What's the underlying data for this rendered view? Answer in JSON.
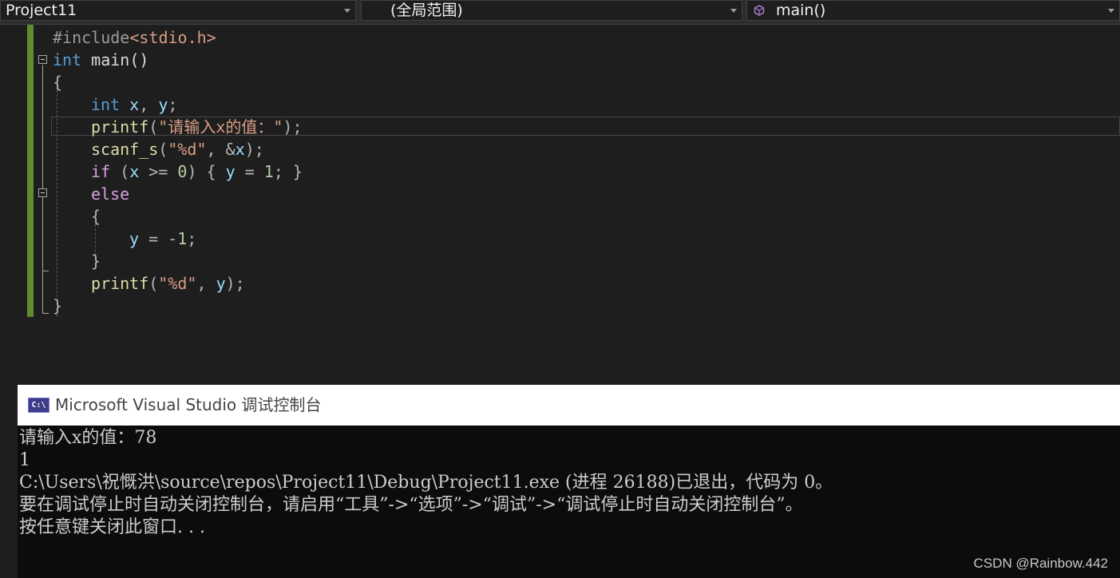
{
  "navbar": {
    "project": "Project11",
    "scope": "(全局范围)",
    "member": "main()"
  },
  "code": {
    "l1": {
      "a": "#include",
      "b": "<stdio.h>"
    },
    "l2": {
      "kw": "int",
      "rest": " main()"
    },
    "l3": "{",
    "l4": {
      "kw": "int",
      "x": "x",
      "comma": ",",
      "y": "y",
      "semi": ";"
    },
    "l5": {
      "fn": "printf",
      "open": "(",
      "str": "\"请输入x的值：\"",
      "close": ");"
    },
    "l6": {
      "fn": "scanf_s",
      "open": "(",
      "str": "\"%d\"",
      "comma": ", &",
      "x": "x",
      "close": ");"
    },
    "l7": {
      "kw": "if",
      "p1": " (",
      "x": "x",
      "op": " >= ",
      "n0": "0",
      "p2": ") { ",
      "y": "y",
      "eq": " = ",
      "n1": "1",
      "end": "; }"
    },
    "l8": "else",
    "l9": "{",
    "l10": {
      "y": "y",
      "eq": " = -",
      "n": "1",
      "semi": ";"
    },
    "l11": "}",
    "l12": {
      "fn": "printf",
      "open": "(",
      "str": "\"%d\"",
      "comma": ", ",
      "y": "y",
      "close": ");"
    },
    "l13": "}"
  },
  "console": {
    "icon_text": "C:\\",
    "title": "Microsoft Visual Studio 调试控制台",
    "lines": [
      "请输入x的值：78",
      "1",
      "C:\\Users\\祝慨洪\\source\\repos\\Project11\\Debug\\Project11.exe (进程 26188)已退出，代码为 0。",
      "要在调试停止时自动关闭控制台，请启用“工具”->“选项”->“调试”->“调试停止时自动关闭控制台”。",
      "按任意键关闭此窗口. . ."
    ]
  },
  "watermark": "CSDN @Rainbow.442",
  "colors": {
    "keyword": "#569cd6",
    "control_keyword": "#d8a0df",
    "string": "#d69d85",
    "function": "#dcdcaa",
    "variable": "#9cdcfe",
    "number": "#b5cea8",
    "change_bar": "#5f8c2e",
    "editor_bg": "#1e1e1e",
    "console_bg": "#0c0c0c"
  },
  "icons": [
    "chevron-down-icon",
    "cube-icon",
    "console-app-icon",
    "collapse-icon"
  ]
}
